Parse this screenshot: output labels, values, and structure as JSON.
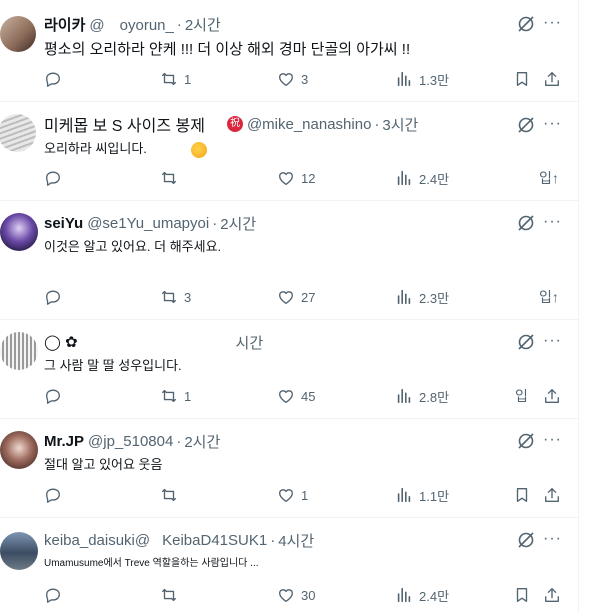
{
  "posts": [
    {
      "name": "라이카",
      "handle": "@　oyorun_",
      "time": "2시간",
      "text": "평소의 오리하라 얀케 !!! 더 이상 해외 경마 단골의 아가씨 !!",
      "actions": {
        "reply": "",
        "repost": "1",
        "like": "3",
        "views": "1.3만"
      }
    },
    {
      "name": "미케몹 보 S 사이즈 봉제",
      "badge": "祝",
      "handle": "@mike_nanashino",
      "time": "3시간",
      "text": "오리하라 씨입니다.",
      "actions": {
        "reply": "",
        "repost": "",
        "like": "12",
        "views": "2.4만",
        "extra": "입↑"
      }
    },
    {
      "name": "seiYu",
      "handle": "@se1Yu_umapyoi",
      "time": "2시간",
      "text": "이것은 알고 있어요. 더 해주세요.",
      "actions": {
        "reply": "",
        "repost": "3",
        "like": "27",
        "views": "2.3만",
        "extra": "입↑"
      }
    },
    {
      "name": "◯ ✿",
      "handle": "",
      "time": "시간",
      "text": "그 사람 말 딸 성우입니다.",
      "actions": {
        "reply": "",
        "repost": "1",
        "like": "45",
        "views": "2.8만",
        "extra": "입"
      }
    },
    {
      "name": "Mr.JP",
      "handle": "@jp_510804",
      "time": "2시간",
      "text": "절대 알고 있어요 웃음",
      "actions": {
        "reply": "",
        "repost": "",
        "like": "1",
        "views": "1.1만"
      }
    },
    {
      "name": "keiba_daisuki@",
      "handle": "KeibaD41SUK1",
      "time": "4시간",
      "text": "Umamusume에서 Treve 역할을하는 사람입니다 ...",
      "actions": {
        "reply": "",
        "repost": "",
        "like": "30",
        "views": "2.4만"
      }
    }
  ],
  "colors": {
    "text": "#0f1419",
    "muted": "#536471",
    "divider": "#eff3f4"
  },
  "icons": [
    "reply-icon",
    "repost-icon",
    "like-icon",
    "views-icon",
    "bookmark-icon",
    "share-icon",
    "grok-icon",
    "more-icon"
  ]
}
